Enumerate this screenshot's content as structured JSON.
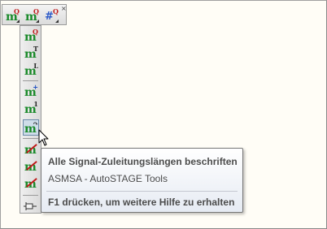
{
  "horizontal_toolbar": {
    "close_glyph": "×",
    "buttons": [
      {
        "icon": "m-q-dropdown-icon",
        "letter": "m",
        "sup": "Q"
      },
      {
        "icon": "m-q-red-dropdown-icon",
        "letter": "m",
        "sup": "Q"
      },
      {
        "icon": "hash-q-dropdown-icon",
        "letter": "#",
        "sup": "Q"
      }
    ]
  },
  "vertical_toolbar": {
    "buttons": [
      {
        "icon": "m-q-icon",
        "letter": "m",
        "sup": "Q"
      },
      {
        "icon": "m-t-icon",
        "letter": "m",
        "sup": "T"
      },
      {
        "icon": "m-l-icon",
        "letter": "m",
        "sup": "L"
      },
      {
        "icon": "m-plus-icon",
        "letter": "m",
        "sup": "+"
      },
      {
        "icon": "m-one-icon",
        "letter": "m",
        "sup": "1"
      },
      {
        "icon": "m-arrow-icon",
        "letter": "m",
        "sup": "↷",
        "pressed": true
      },
      {
        "icon": "m-strike-icon-1",
        "letter": "m",
        "sup": ""
      },
      {
        "icon": "m-strike-icon-2",
        "letter": "m",
        "sup": ""
      },
      {
        "icon": "m-strike-icon-3",
        "letter": "m",
        "sup": ""
      }
    ]
  },
  "tooltip": {
    "title": "Alle Signal-Zuleitungslängen beschriften",
    "body": "ASMSA - AutoSTAGE Tools",
    "help": "F1 drücken, um weitere Hilfe zu erhalten"
  },
  "colors": {
    "green_m": "#1a8a2a",
    "red_accent": "#c01818",
    "blue_accent": "#2050c0",
    "tooltip_text": "#4c4c4c"
  }
}
